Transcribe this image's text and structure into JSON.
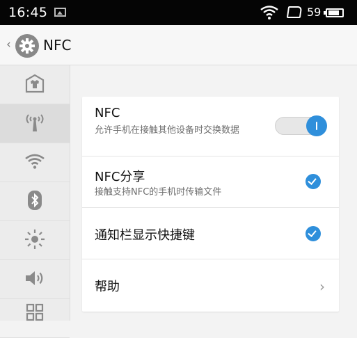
{
  "status_bar": {
    "time": "16:45",
    "battery_percent": "59",
    "icons": [
      "image-icon",
      "wifi-icon",
      "sim-icon",
      "battery-icon"
    ]
  },
  "header": {
    "back_glyph": "‹",
    "icon": "gear-icon",
    "title": "NFC"
  },
  "sidebar": {
    "items": [
      {
        "name": "home-icon",
        "active": false
      },
      {
        "name": "nfc-antenna-icon",
        "active": true
      },
      {
        "name": "wifi-icon",
        "active": false
      },
      {
        "name": "bluetooth-icon",
        "active": false
      },
      {
        "name": "brightness-icon",
        "active": false
      },
      {
        "name": "volume-icon",
        "active": false
      },
      {
        "name": "apps-grid-icon",
        "active": false
      }
    ]
  },
  "settings": {
    "nfc": {
      "title": "NFC",
      "subtitle": "允许手机在接触其他设备时交换数据",
      "enabled": true
    },
    "nfc_share": {
      "title": "NFC分享",
      "subtitle": "接触支持NFC的手机时传输文件",
      "checked": true
    },
    "notification_shortcut": {
      "title": "通知栏显示快捷键",
      "checked": true
    },
    "help": {
      "title": "帮助",
      "chevron": "›"
    }
  },
  "colors": {
    "accent": "#2f8fdb",
    "statusbar": "#050505",
    "background": "#f3f3f3"
  }
}
